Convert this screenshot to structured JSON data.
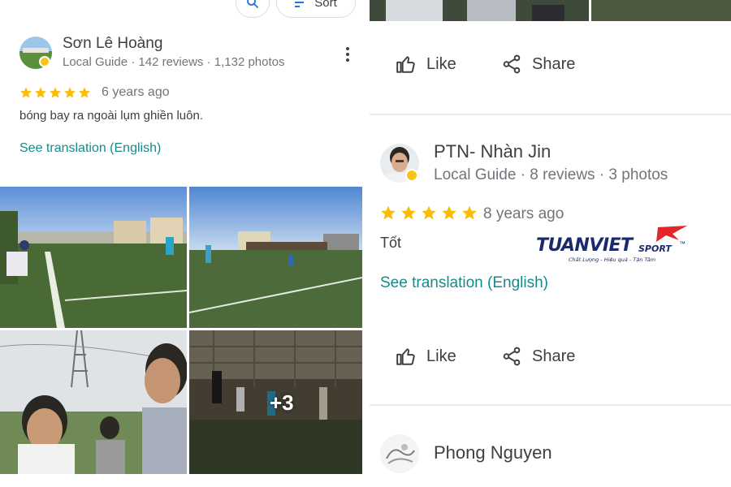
{
  "toolbar": {
    "search_icon": "search-icon",
    "sort_label": "Sort"
  },
  "review1": {
    "name": "Sơn Lê Hoàng",
    "meta": "Local Guide · 142 reviews · 1,132 photos",
    "rating": 5,
    "date": "6 years ago",
    "text": "bóng bay ra ngoài lụm ghiền luôn.",
    "translate": "See translation (English)",
    "more_photos": "+3"
  },
  "actions": {
    "like": "Like",
    "share": "Share"
  },
  "review2": {
    "name": "PTN- Nhàn Jin",
    "meta": "Local Guide · 8 reviews · 3 photos",
    "rating": 5,
    "date": "8 years ago",
    "text": "Tốt",
    "translate": "See translation (English)"
  },
  "review3": {
    "name": "Phong Nguyen"
  },
  "watermark": {
    "brand": "TUANVIET",
    "sub": "SPORT",
    "tm": "™",
    "tagline": "Chất Lượng - Hiệu quả - Tận Tâm"
  },
  "colors": {
    "star": "#fbbc04",
    "link": "#168a8a",
    "brand_navy": "#1a2b6d",
    "brand_red": "#e4252c"
  }
}
